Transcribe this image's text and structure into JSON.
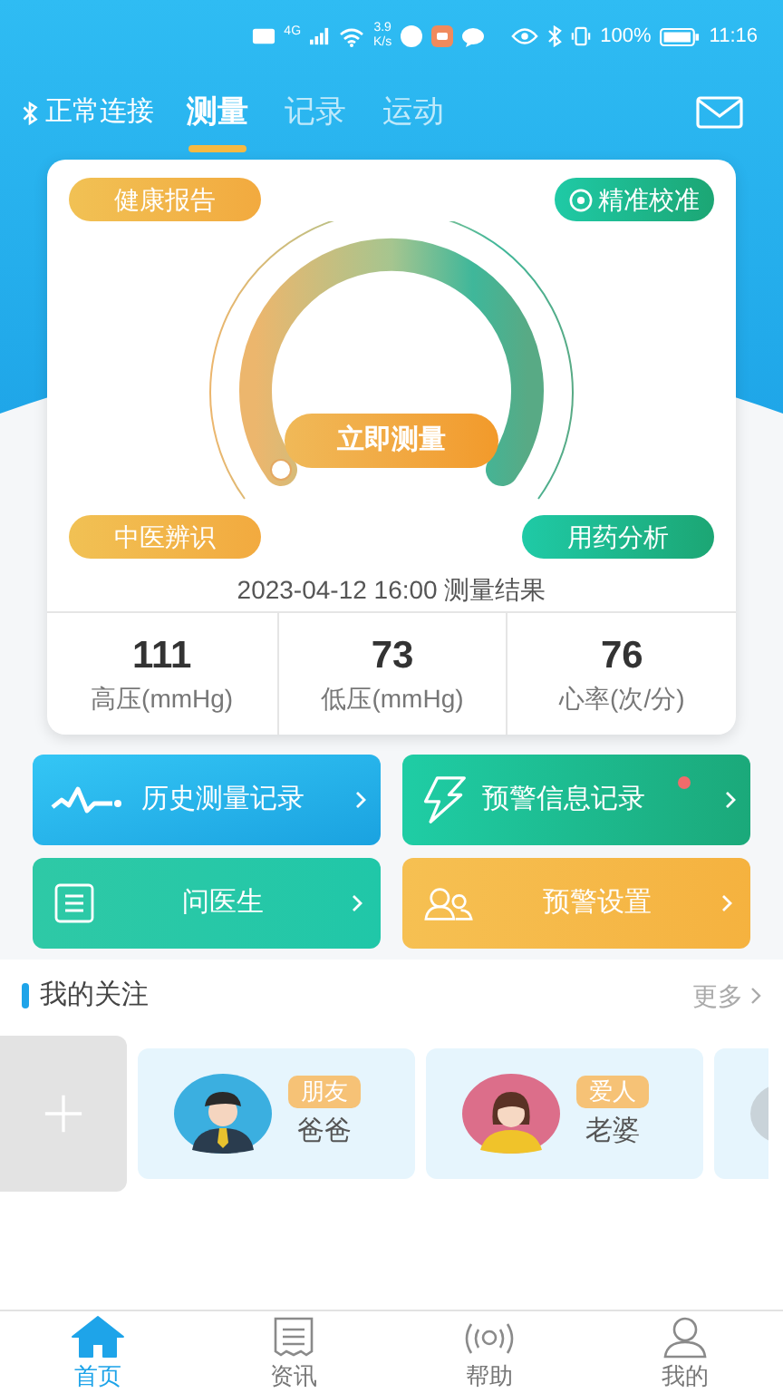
{
  "status_bar": {
    "network": "4G",
    "speed_value": "3.9",
    "speed_unit": "K/s",
    "battery": "100%",
    "time": "11:16"
  },
  "header": {
    "connection": "正常连接",
    "tabs": [
      {
        "label": "测量",
        "selected": true
      },
      {
        "label": "记录",
        "selected": false
      },
      {
        "label": "运动",
        "selected": false
      }
    ]
  },
  "card": {
    "top_left": "健康报告",
    "top_right": "精准校准",
    "measure_button": "立即测量",
    "bottom_left": "中医辨识",
    "bottom_right": "用药分析",
    "result_caption": "2023-04-12 16:00 测量结果",
    "readings": [
      {
        "value": "111",
        "label": "高压(mmHg)"
      },
      {
        "value": "73",
        "label": "低压(mmHg)"
      },
      {
        "value": "76",
        "label": "心率(次/分)"
      }
    ]
  },
  "shortcuts": [
    {
      "kind": "history",
      "label": "历史测量记录",
      "alert": false
    },
    {
      "kind": "warning",
      "label": "预警信息记录",
      "alert": true
    },
    {
      "kind": "doctor",
      "label": "问医生",
      "alert": false
    },
    {
      "kind": "settings",
      "label": "预警设置",
      "alert": false
    }
  ],
  "follows": {
    "title": "我的关注",
    "more": "更多",
    "people": [
      {
        "kind": "male",
        "tag": "朋友",
        "name": "爸爸"
      },
      {
        "kind": "female",
        "tag": "爱人",
        "name": "老婆"
      },
      {
        "kind": "partial"
      }
    ]
  },
  "bottom_nav": [
    {
      "kind": "home",
      "label": "首页",
      "selected": true
    },
    {
      "kind": "news",
      "label": "资讯",
      "selected": false
    },
    {
      "kind": "help",
      "label": "帮助",
      "selected": false
    },
    {
      "kind": "me",
      "label": "我的",
      "selected": false
    }
  ]
}
